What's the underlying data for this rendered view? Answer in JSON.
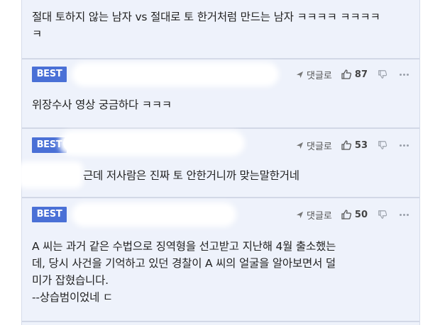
{
  "comments": [
    {
      "has_header": false,
      "text": "절대 토하지 않는 남자 vs 절대로 토 한거처럼 만드는 남자 ㅋㅋㅋㅋ ㅋㅋㅋㅋㅋ"
    },
    {
      "badge": "BEST",
      "reply_label": "댓글로",
      "likes": "87",
      "text": "위장수사 영상 궁금하다 ㅋㅋㅋ"
    },
    {
      "badge": "BEST",
      "reply_label": "댓글로",
      "likes": "53",
      "text": "근데 저사람은 진짜 토 안한거니까 맞는말한거네"
    },
    {
      "badge": "BEST",
      "reply_label": "댓글로",
      "likes": "50",
      "text_lines": [
        "A 씨는 과거 같은 수법으로 징역형을 선고받고 지난해 4월 출소했는",
        "데, 당시 사건을 기억하고 있던 경찰이 A 씨의 얼굴을 알아보면서 덜",
        "미가 잡혔습니다.",
        "--상습범이었네 ㄷ"
      ]
    }
  ],
  "icons": {
    "reply": "reply-arrow-icon",
    "like": "thumbs-up-icon",
    "dislike": "thumbs-down-icon",
    "more": "more-dots-icon"
  },
  "colors": {
    "badge": "#4a70d6",
    "background": "#eef2fb"
  }
}
